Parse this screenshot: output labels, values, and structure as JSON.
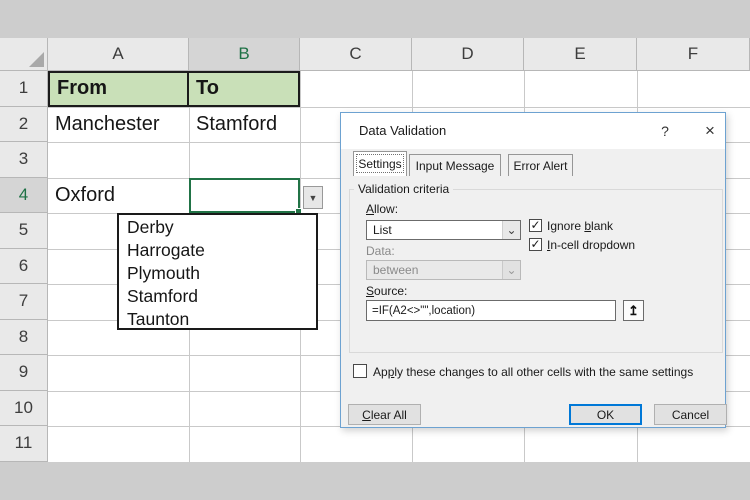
{
  "sheet": {
    "columns": [
      "A",
      "B",
      "C",
      "D",
      "E",
      "F"
    ],
    "rows": [
      "1",
      "2",
      "3",
      "4",
      "5",
      "6",
      "7",
      "8",
      "9",
      "10",
      "11"
    ],
    "cells": {
      "a1": "From",
      "b1": "To",
      "a2": "Manchester",
      "b2": "Stamford",
      "a4": "Oxford"
    }
  },
  "dropdown": {
    "items": [
      "Derby",
      "Harrogate",
      "Plymouth",
      "Stamford",
      "Taunton"
    ]
  },
  "dialog": {
    "title": "Data Validation",
    "tabs": [
      {
        "label": "Settings",
        "active": true
      },
      {
        "label": "Input Message",
        "active": false
      },
      {
        "label": "Error Alert",
        "active": false
      }
    ],
    "group_label": "Validation criteria",
    "allow": {
      "label": {
        "pre": "",
        "accel": "A",
        "post": "llow:"
      },
      "value": "List"
    },
    "ignore_blank": {
      "label": {
        "pre": "Ignore ",
        "accel": "b",
        "post": "lank"
      },
      "checked": true
    },
    "in_cell_dropdown": {
      "label": {
        "pre": "",
        "accel": "I",
        "post": "n-cell dropdown"
      },
      "checked": true
    },
    "data": {
      "label": "Data:",
      "value": "between",
      "disabled": true
    },
    "source": {
      "label": {
        "pre": "",
        "accel": "S",
        "post": "ource:"
      },
      "value": "=IF(A2<>\"\",location)"
    },
    "apply": {
      "label": {
        "pre": "Ap",
        "accel": "p",
        "post": "ly these changes to all other cells with the same settings"
      },
      "checked": false
    },
    "buttons": {
      "clear": {
        "pre": "",
        "accel": "C",
        "post": "lear All"
      },
      "ok": "OK",
      "cancel": "Cancel"
    }
  },
  "icons": {
    "check": "✓",
    "chevron_down": "⌄",
    "cell_dropdown_arrow": "▼",
    "collapse_dialog": "↥",
    "help": "?",
    "close": "×"
  },
  "colors": {
    "selection_green": "#217346",
    "header_green": "#1e7145",
    "cell_fill_green": "#c9e0b8",
    "dialog_border_blue": "#6da2d1",
    "ok_default_blue": "#0078d7"
  }
}
